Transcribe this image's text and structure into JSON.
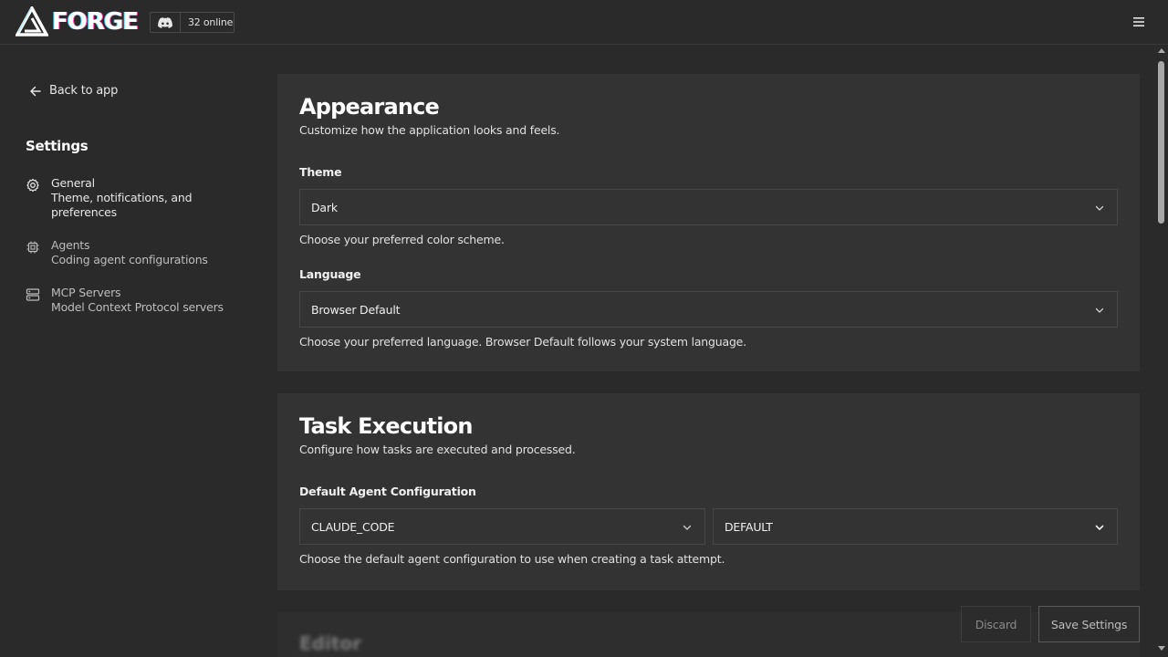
{
  "header": {
    "logo_text": "FORGE",
    "discord_online": "32 online",
    "icons": {
      "logo": "forge-logo-icon",
      "discord": "discord-icon",
      "menu": "hamburger-menu-icon"
    }
  },
  "sidebar": {
    "back_label": "Back to app",
    "heading": "Settings",
    "items": [
      {
        "title": "General",
        "description": "Theme, notifications, and preferences",
        "icon": "gear-icon"
      },
      {
        "title": "Agents",
        "description": "Coding agent configurations",
        "icon": "cpu-icon"
      },
      {
        "title": "MCP Servers",
        "description": "Model Context Protocol servers",
        "icon": "server-icon"
      }
    ]
  },
  "appearance": {
    "title": "Appearance",
    "subtitle": "Customize how the application looks and feels.",
    "theme": {
      "label": "Theme",
      "value": "Dark",
      "help": "Choose your preferred color scheme."
    },
    "language": {
      "label": "Language",
      "value": "Browser Default",
      "help": "Choose your preferred language. Browser Default follows your system language."
    }
  },
  "task_execution": {
    "title": "Task Execution",
    "subtitle": "Configure how tasks are executed and processed.",
    "agent_config": {
      "label": "Default Agent Configuration",
      "agent_value": "CLAUDE_CODE",
      "variant_value": "DEFAULT",
      "help": "Choose the default agent configuration to use when creating a task attempt."
    }
  },
  "editor": {
    "title": "Editor"
  },
  "footer": {
    "discard_label": "Discard",
    "save_label": "Save Settings"
  },
  "colors": {
    "background": "#2a2a2a",
    "card": "#333333",
    "border": "#474747",
    "text": "#e6e6e6"
  }
}
